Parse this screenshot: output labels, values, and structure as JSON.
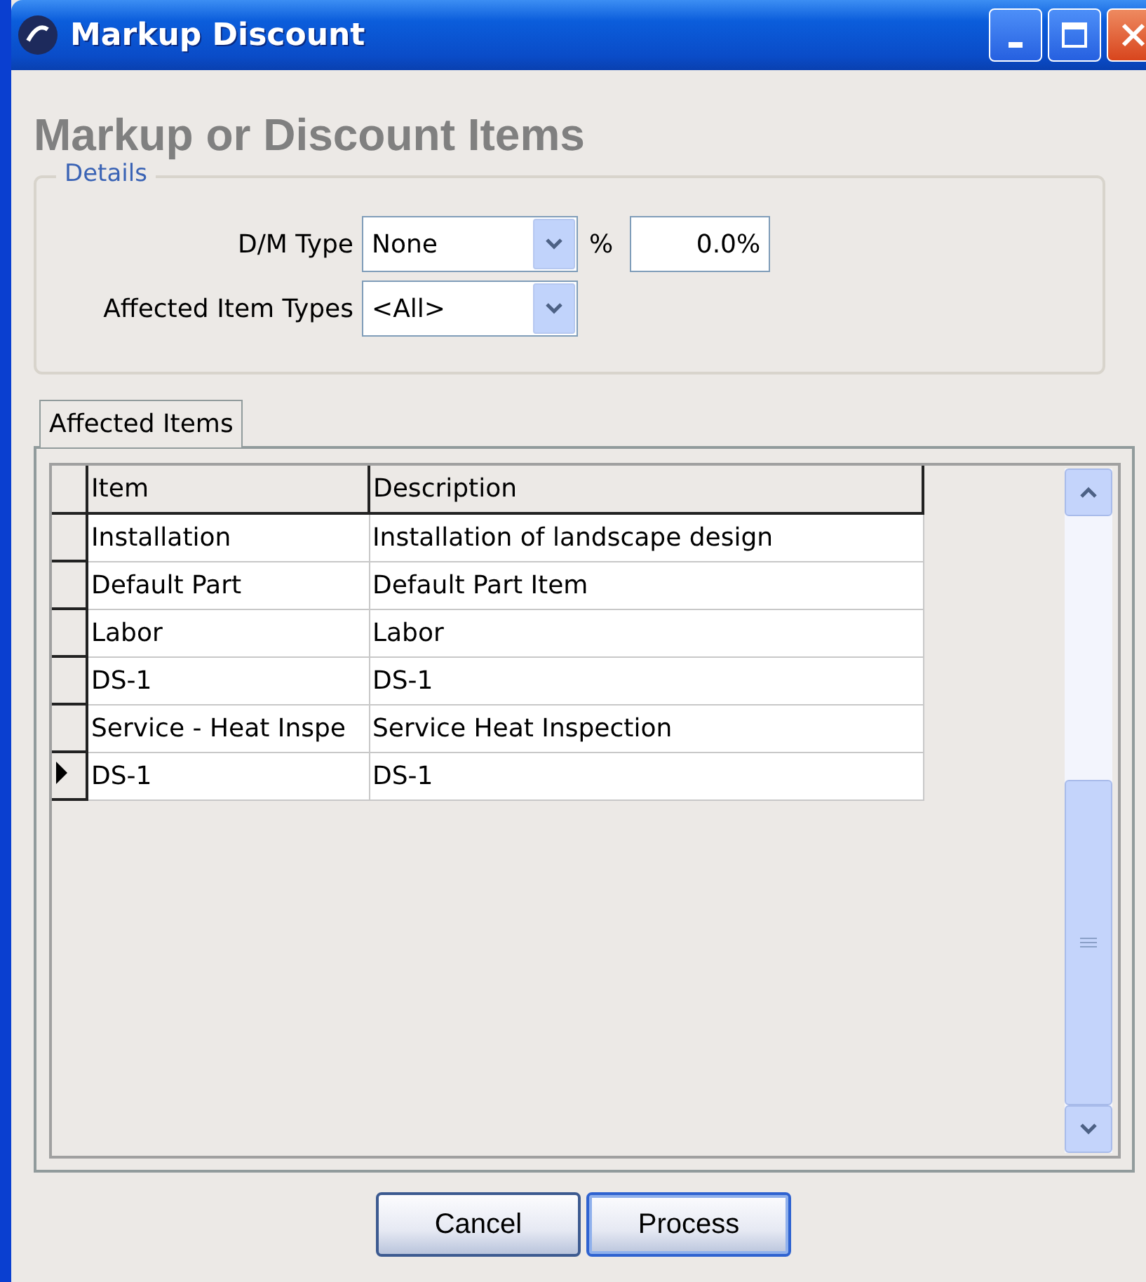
{
  "window": {
    "title": "Markup Discount"
  },
  "heading": "Markup or Discount Items",
  "details": {
    "legend": "Details",
    "fields": [
      {
        "kind": "combo",
        "label": "D/M Type",
        "value": "None",
        "suffix_label": "%",
        "suffix_value": "0.0%"
      },
      {
        "kind": "combo",
        "label": "Affected Item Types",
        "value": "<All>"
      }
    ]
  },
  "tabs": [
    {
      "label": "Affected Items",
      "selected": true
    }
  ],
  "table": {
    "columns": [
      "Item",
      "Description"
    ],
    "rows": [
      {
        "cells": [
          "Installation",
          "Installation of landscape design"
        ],
        "selected": false
      },
      {
        "cells": [
          "Default Part",
          "Default Part Item"
        ],
        "selected": false
      },
      {
        "cells": [
          "Labor",
          "Labor"
        ],
        "selected": false
      },
      {
        "cells": [
          "DS-1",
          "DS-1"
        ],
        "selected": false
      },
      {
        "cells": [
          "Service - Heat Inspe",
          "Service Heat Inspection"
        ],
        "selected": false
      },
      {
        "cells": [
          "DS-1",
          "DS-1"
        ],
        "selected": true
      }
    ]
  },
  "buttons": [
    {
      "label": "Cancel",
      "default": false
    },
    {
      "label": "Process",
      "default": true
    }
  ]
}
